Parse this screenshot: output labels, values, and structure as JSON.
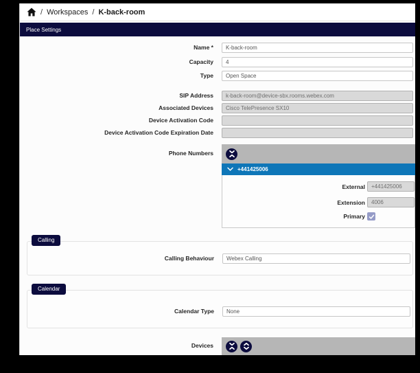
{
  "breadcrumb": {
    "sep1": "/",
    "sep2": "/",
    "workspaces": "Workspaces",
    "current": "K-back-room"
  },
  "header": {
    "title": "Place Settings"
  },
  "form": {
    "fields": [
      {
        "label": "Name *",
        "value": "K-back-room",
        "state": "enabled"
      },
      {
        "label": "Capacity",
        "value": "4",
        "state": "enabled"
      },
      {
        "label": "Type",
        "value": "Open Space",
        "state": "enabled"
      },
      {
        "label": "SIP Address",
        "value": "k-back-room@device-sbx.rooms.webex.com",
        "state": "disabled"
      },
      {
        "label": "Associated Devices",
        "value": "Cisco TelePresence SX10",
        "state": "disabled"
      },
      {
        "label": "Device Activation Code",
        "value": "",
        "state": "disabled"
      },
      {
        "label": "Device Activation Code Expiration Date",
        "value": "",
        "state": "disabled"
      }
    ]
  },
  "phone": {
    "label": "Phone Numbers",
    "entry": {
      "number": "+441425006",
      "expanded": true,
      "external_label": "External",
      "external_value": "+441425006",
      "extension_label": "Extension",
      "extension_value": "4006",
      "primary_label": "Primary",
      "primary_checked": true
    }
  },
  "calling": {
    "badge": "Calling",
    "behaviour_label": "Calling Behaviour",
    "behaviour_value": "Webex Calling"
  },
  "calendar": {
    "badge": "Calendar",
    "type_label": "Calendar Type",
    "type_value": "None"
  },
  "devices": {
    "label": "Devices"
  },
  "icons": {
    "home": "home-icon",
    "collapse": "collapse-all-icon",
    "expand": "expand-all-icon",
    "chevron_down": "chevron-down-icon",
    "check": "checkmark-icon"
  },
  "colors": {
    "navy": "#0c0c3e",
    "blue": "#0e76b8",
    "panel": "#b6b6b6",
    "checkbox": "#959bc7"
  }
}
